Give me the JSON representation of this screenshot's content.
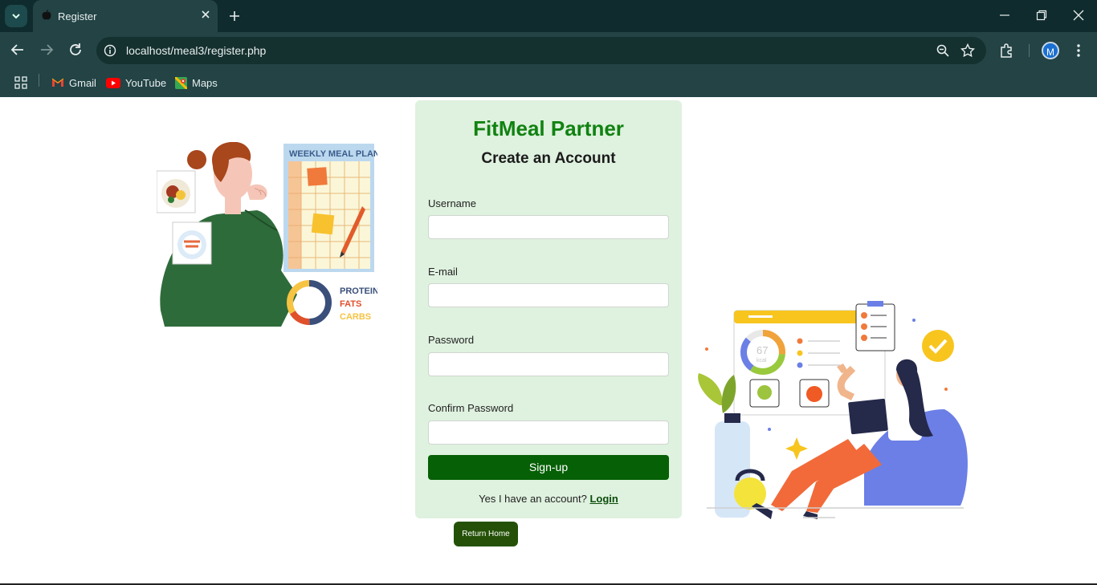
{
  "browser": {
    "tab_title": "Register",
    "url": "localhost/meal3/register.php",
    "profile_initial": "M",
    "bookmarks": [
      {
        "label": "Gmail",
        "icon": "gmail-icon"
      },
      {
        "label": "YouTube",
        "icon": "youtube-icon"
      },
      {
        "label": "Maps",
        "icon": "maps-icon"
      }
    ]
  },
  "form": {
    "brand": "FitMeal Partner",
    "subtitle": "Create an Account",
    "username_label": "Username",
    "username_value": "",
    "email_label": "E-mail",
    "email_value": "",
    "password_label": "Password",
    "password_value": "",
    "confirm_label": "Confirm Password",
    "confirm_value": "",
    "signup_label": "Sign-up",
    "login_prompt": "Yes I have an account?",
    "login_link": "Login",
    "return_home": "Return Home"
  },
  "illustration_left": {
    "plan_title": "WEEKLY MEAL PLAN",
    "legend": [
      "PROTEIN",
      "FATS",
      "CARBS"
    ]
  },
  "illustration_right": {
    "kcal_value": "67",
    "kcal_unit": "kcal"
  },
  "colors": {
    "brand_green": "#118211",
    "button_green": "#066006",
    "card_bg": "#dff1df",
    "home_button": "#245107"
  }
}
